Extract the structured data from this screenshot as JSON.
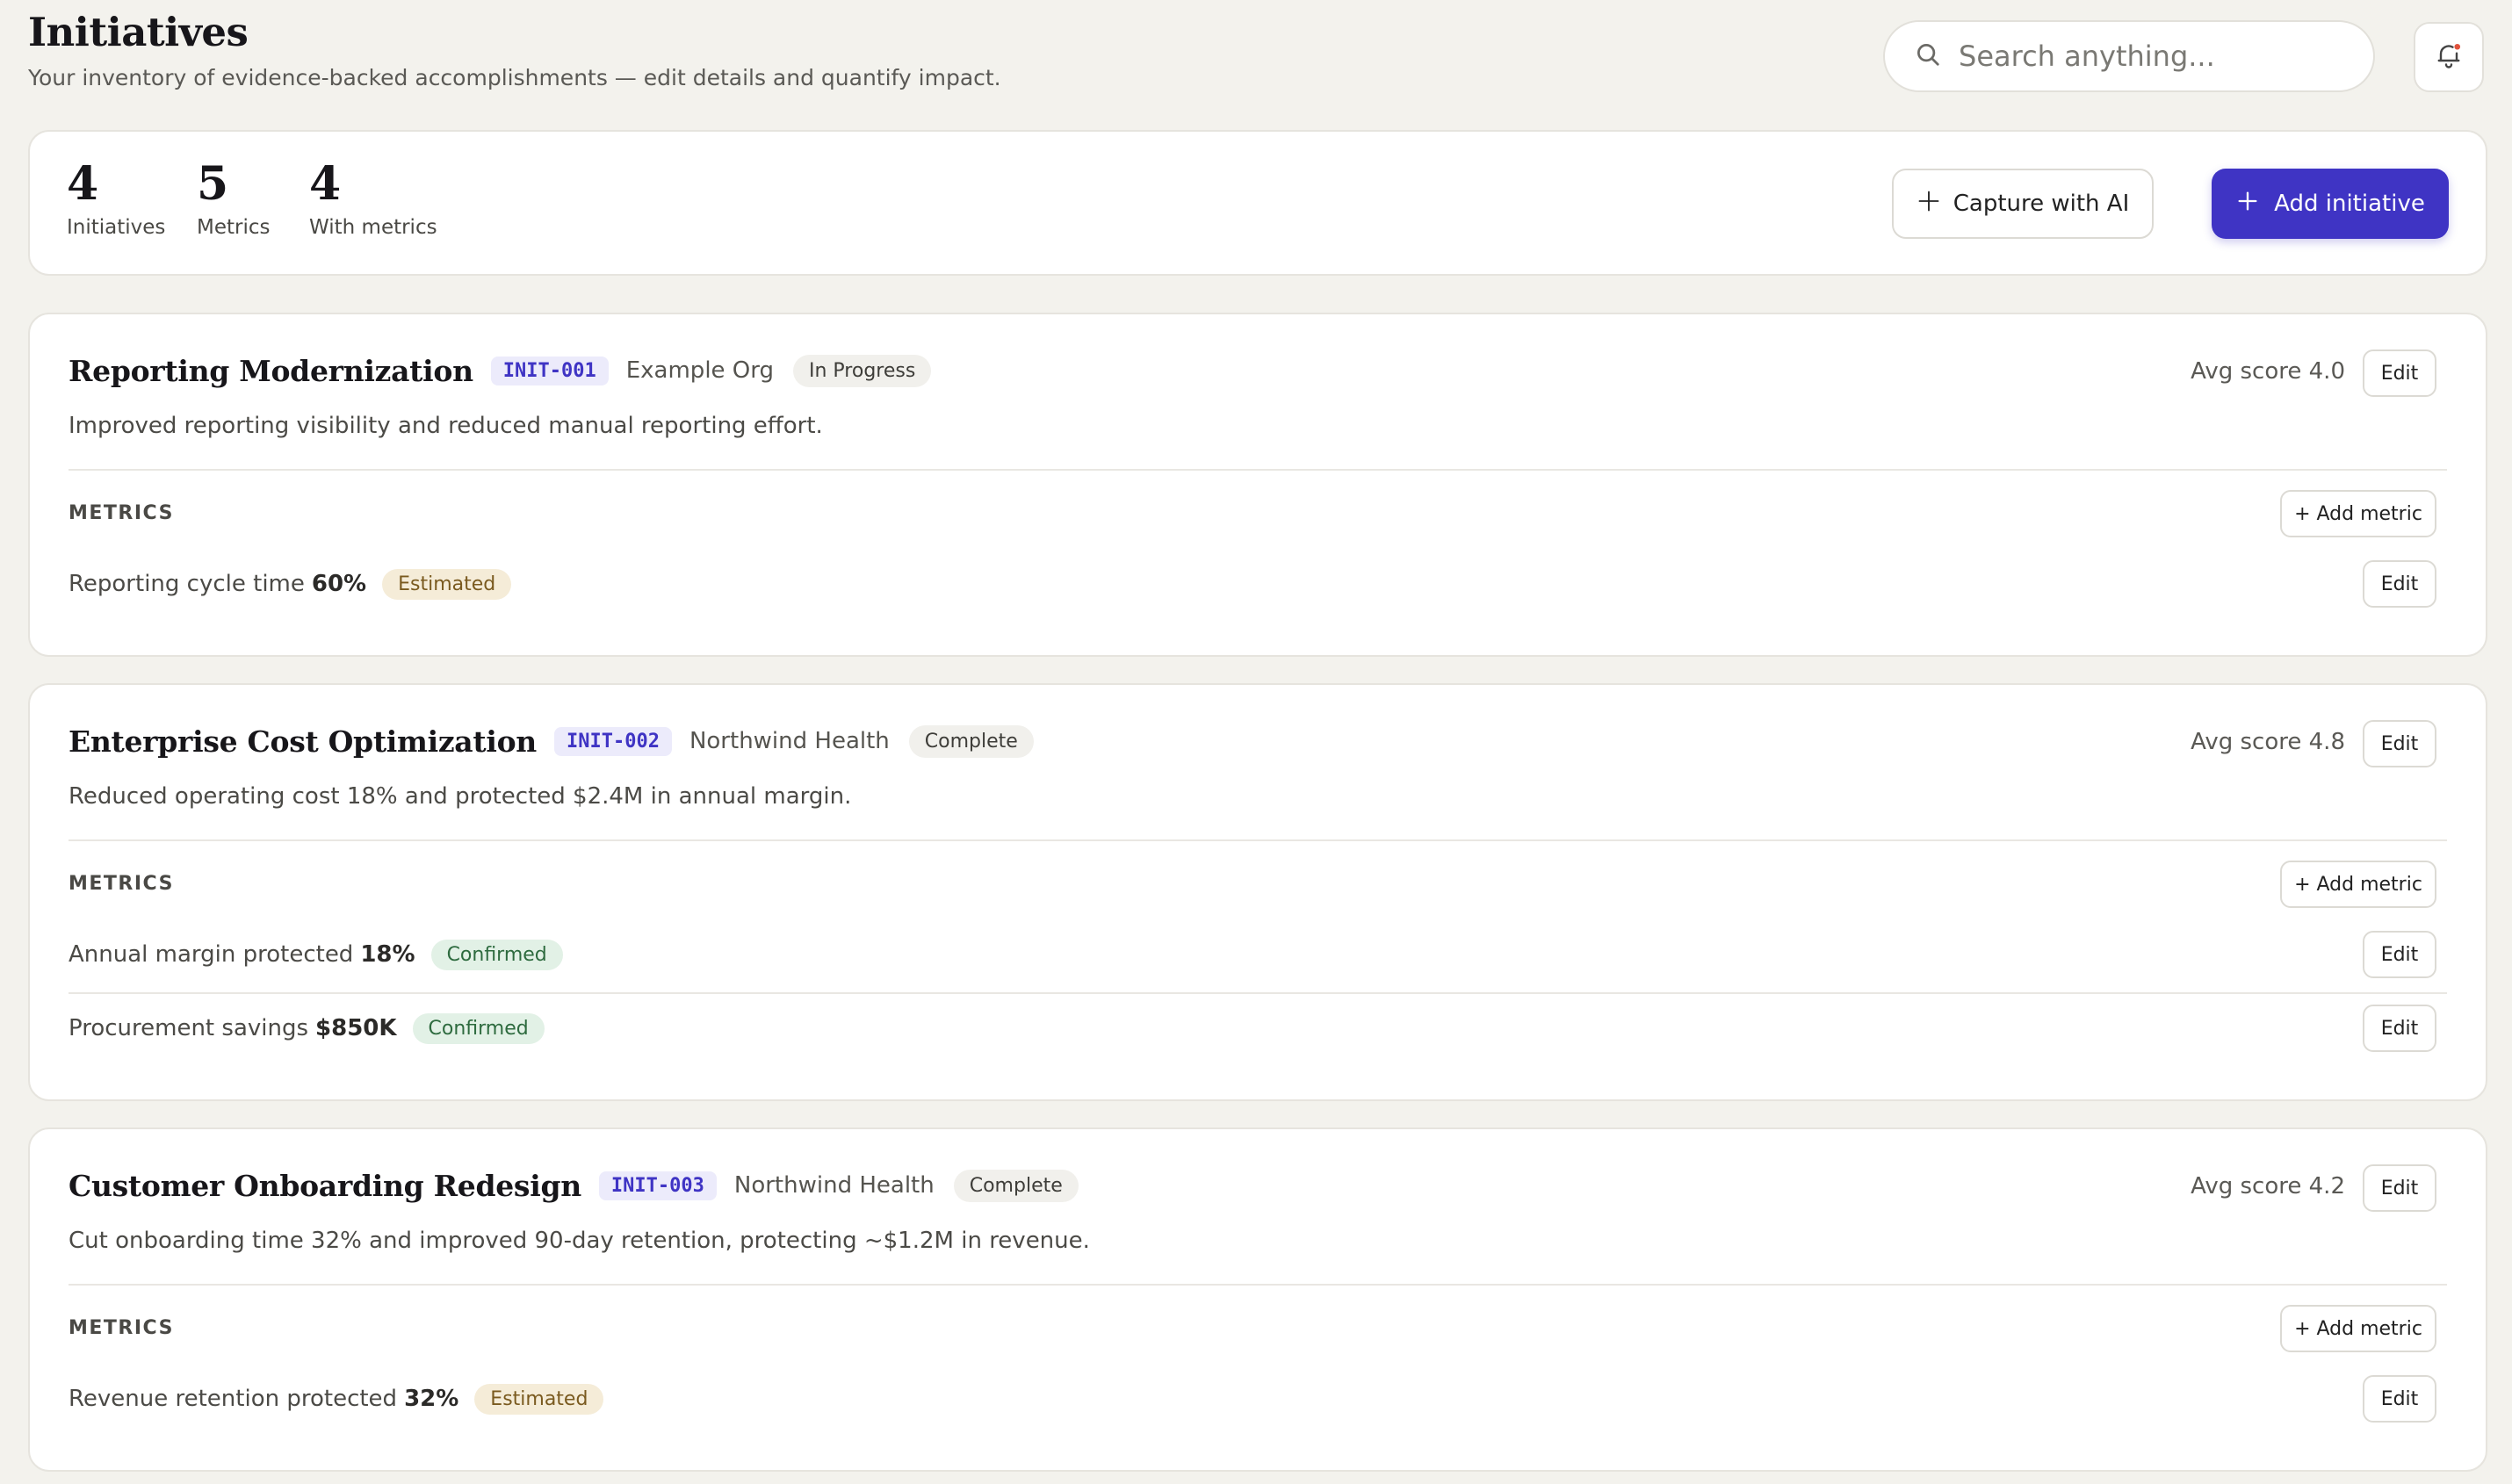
{
  "header": {
    "title": "Initiatives",
    "subtitle": "Your inventory of evidence-backed accomplishments — edit details and quantify impact.",
    "search_placeholder": "Search anything..."
  },
  "stats": [
    {
      "value": "4",
      "label": "Initiatives"
    },
    {
      "value": "5",
      "label": "Metrics"
    },
    {
      "value": "4",
      "label": "With metrics"
    }
  ],
  "actions": {
    "capture_label": "Capture with AI",
    "add_label": "Add initiative"
  },
  "colors": {
    "accent": "#3f34c4",
    "background": "#f3f2ed",
    "estimated_bg": "#f5ecd8",
    "confirmed_bg": "#e2f1e6"
  },
  "initiatives": [
    {
      "title": "Reporting Modernization",
      "id": "INIT-001",
      "org": "Example Org",
      "status": "In Progress",
      "score": "Avg score 4.0",
      "description": "Improved reporting visibility and reduced manual reporting effort.",
      "metrics_label": "METRICS",
      "add_metric_label": "+ Add metric",
      "edit_label": "Edit",
      "metrics": [
        {
          "name": "Reporting cycle time",
          "value": "60%",
          "badge": "Estimated",
          "edit_label": "Edit"
        }
      ]
    },
    {
      "title": "Enterprise Cost Optimization",
      "id": "INIT-002",
      "org": "Northwind Health",
      "status": "Complete",
      "score": "Avg score 4.8",
      "description": "Reduced operating cost 18% and protected $2.4M in annual margin.",
      "metrics_label": "METRICS",
      "add_metric_label": "+ Add metric",
      "edit_label": "Edit",
      "metrics": [
        {
          "name": "Annual margin protected",
          "value": "18%",
          "badge": "Confirmed",
          "edit_label": "Edit"
        },
        {
          "name": "Procurement savings",
          "value": "$850K",
          "badge": "Confirmed",
          "edit_label": "Edit"
        }
      ]
    },
    {
      "title": "Customer Onboarding Redesign",
      "id": "INIT-003",
      "org": "Northwind Health",
      "status": "Complete",
      "score": "Avg score 4.2",
      "description": "Cut onboarding time 32% and improved 90-day retention, protecting ~$1.2M in revenue.",
      "metrics_label": "METRICS",
      "add_metric_label": "+ Add metric",
      "edit_label": "Edit",
      "metrics": [
        {
          "name": "Revenue retention protected",
          "value": "32%",
          "badge": "Estimated",
          "edit_label": "Edit"
        }
      ]
    }
  ]
}
